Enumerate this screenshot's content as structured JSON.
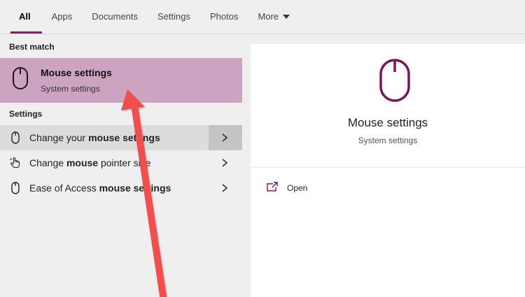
{
  "tabs": [
    {
      "label": "All",
      "active": true
    },
    {
      "label": "Apps"
    },
    {
      "label": "Documents"
    },
    {
      "label": "Settings"
    },
    {
      "label": "Photos"
    },
    {
      "label": "More"
    }
  ],
  "left": {
    "best_match_label": "Best match",
    "best_match": {
      "title": "Mouse settings",
      "subtitle": "System settings",
      "icon": "mouse-icon"
    },
    "settings_label": "Settings",
    "items": [
      {
        "pre": "Change your ",
        "bold": "mouse settings",
        "post": "",
        "icon": "mouse-icon",
        "hover": true
      },
      {
        "pre": "Change ",
        "bold": "mouse",
        "post": " pointer size",
        "icon": "pointer-hand-icon"
      },
      {
        "pre": "Ease of Access ",
        "bold": "mouse settings",
        "post": "",
        "icon": "mouse-icon"
      }
    ]
  },
  "right": {
    "title": "Mouse settings",
    "subtitle": "System settings",
    "open_label": "Open"
  },
  "colors": {
    "accent": "#8b1d6b",
    "highlight": "#cca4c1",
    "arrow": "#f0504d"
  }
}
